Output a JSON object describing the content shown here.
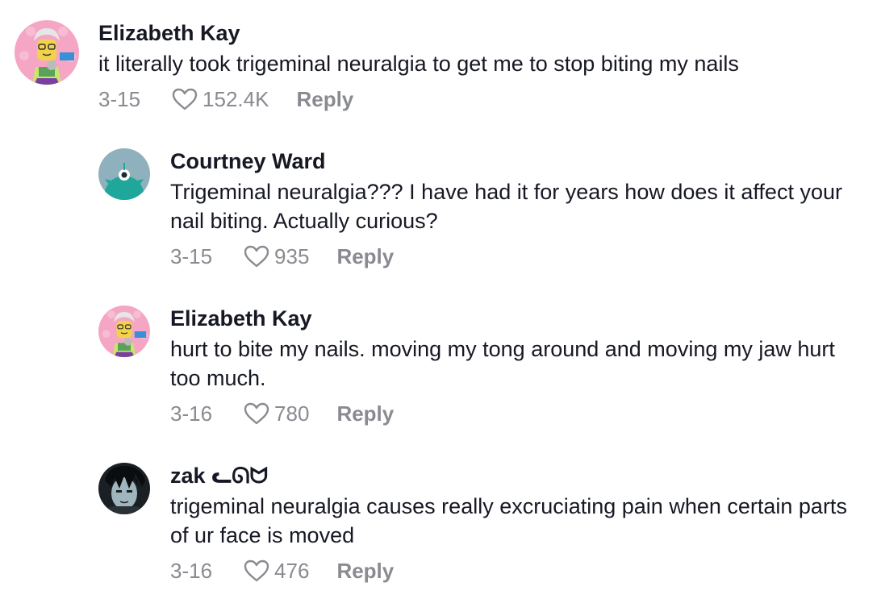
{
  "comments": [
    {
      "author": "Elizabeth Kay",
      "text": "it literally took trigeminal neuralgia to get me to stop biting my nails",
      "date": "3-15",
      "likes": "152.4K",
      "reply_label": "Reply",
      "avatar_icon": "lego-figure-avatar"
    },
    {
      "author": "Courtney Ward",
      "text": "Trigeminal neuralgia??? I have had it for years how does it affect your nail biting. Actually curious?",
      "date": "3-15",
      "likes": "935",
      "reply_label": "Reply",
      "avatar_icon": "teal-monster-avatar"
    },
    {
      "author": "Elizabeth Kay",
      "text": "hurt to bite my nails. moving my tong around and moving my jaw hurt too much.",
      "date": "3-16",
      "likes": "780",
      "reply_label": "Reply",
      "avatar_icon": "lego-figure-avatar"
    },
    {
      "author": "zak ᓚᘏᗢ",
      "text": "trigeminal neuralgia causes really excruciating pain when certain parts of ur face is moved",
      "date": "3-16",
      "likes": "476",
      "reply_label": "Reply",
      "avatar_icon": "dark-portrait-avatar"
    }
  ],
  "colors": {
    "text_primary": "#161823",
    "text_secondary": "#8a8b91",
    "background": "#ffffff"
  }
}
